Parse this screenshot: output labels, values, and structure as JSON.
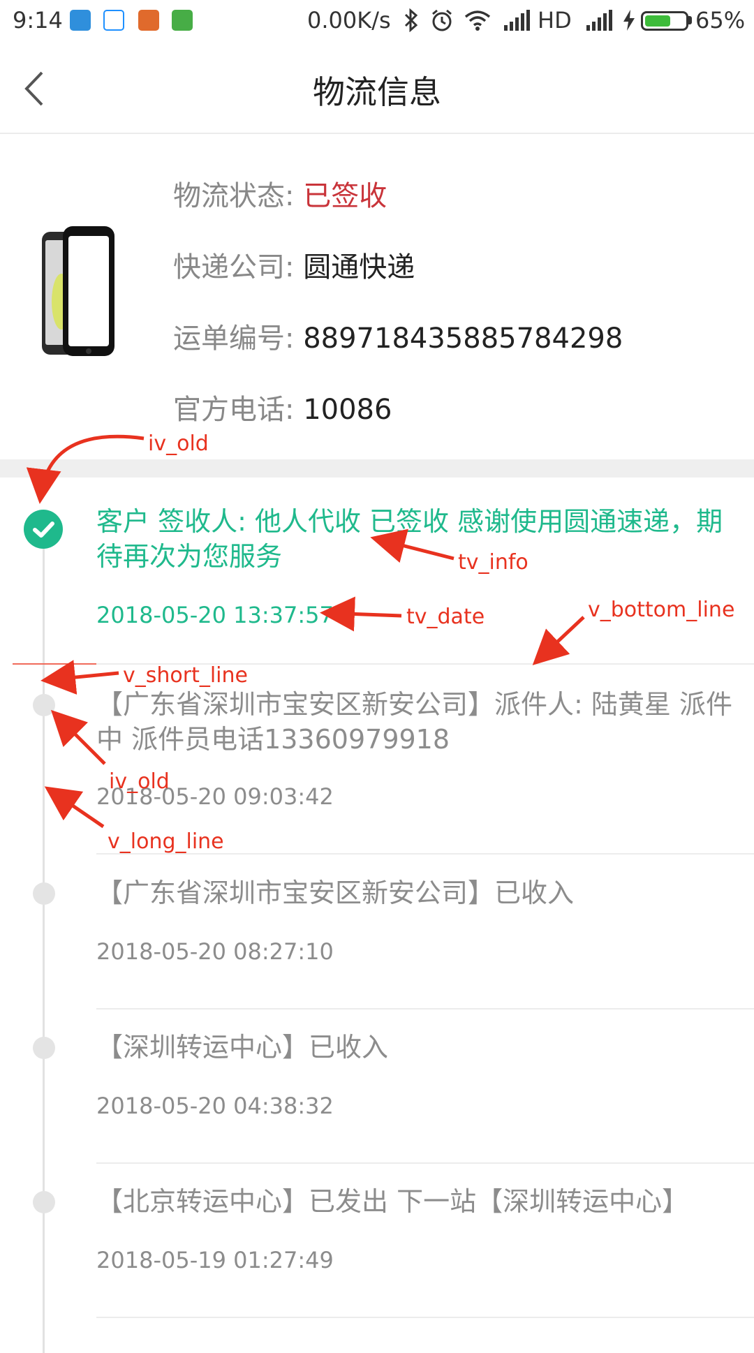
{
  "status_bar": {
    "time": "9:14",
    "network_speed": "0.00K/s",
    "signal_label": "HD",
    "battery_percent": "65%",
    "battery_level": 0.65,
    "icons": [
      "usb-icon",
      "alipay-icon",
      "app-icon",
      "android-icon",
      "bluetooth-icon",
      "alarm-icon",
      "wifi-icon",
      "signal-icon",
      "charging-icon",
      "battery-icon"
    ]
  },
  "header": {
    "title": "物流信息",
    "back_icon": "chevron-left-icon"
  },
  "logistics": {
    "status_label": "物流状态:",
    "status_value": "已签收",
    "company_label": "快递公司:",
    "company_value": "圆通快递",
    "waybill_label": "运单编号:",
    "waybill_value": "889718435885784298",
    "phone_label": "官方电话:",
    "phone_value": "10086",
    "status_color": "#c9343a"
  },
  "timeline": [
    {
      "info": "客户 签收人: 他人代收 已签收 感谢使用圆通速递，期待再次为您服务",
      "date": "2018-05-20 13:37:57",
      "active": true
    },
    {
      "info": "【广东省深圳市宝安区新安公司】派件人: 陆黄星 派件中 派件员电话13360979918",
      "date": "2018-05-20 09:03:42",
      "active": false
    },
    {
      "info": "【广东省深圳市宝安区新安公司】已收入",
      "date": "2018-05-20 08:27:10",
      "active": false
    },
    {
      "info": "【深圳转运中心】已收入",
      "date": "2018-05-20 04:38:32",
      "active": false
    },
    {
      "info": "【北京转运中心】已发出 下一站【深圳转运中心】",
      "date": "2018-05-19 01:27:49",
      "active": false
    }
  ],
  "annotations": {
    "iv_old_top": "iv_old",
    "tv_info": "tv_info",
    "tv_date": "tv_date",
    "v_bottom_line": "v_bottom_line",
    "v_short_line": "v_short_line",
    "iv_old_mid": "iv_old",
    "v_long_line": "v_long_line"
  },
  "colors": {
    "accent_green": "#1fb98c",
    "annotation_red": "#e8321f",
    "inactive_dot": "#e4e4e4"
  }
}
